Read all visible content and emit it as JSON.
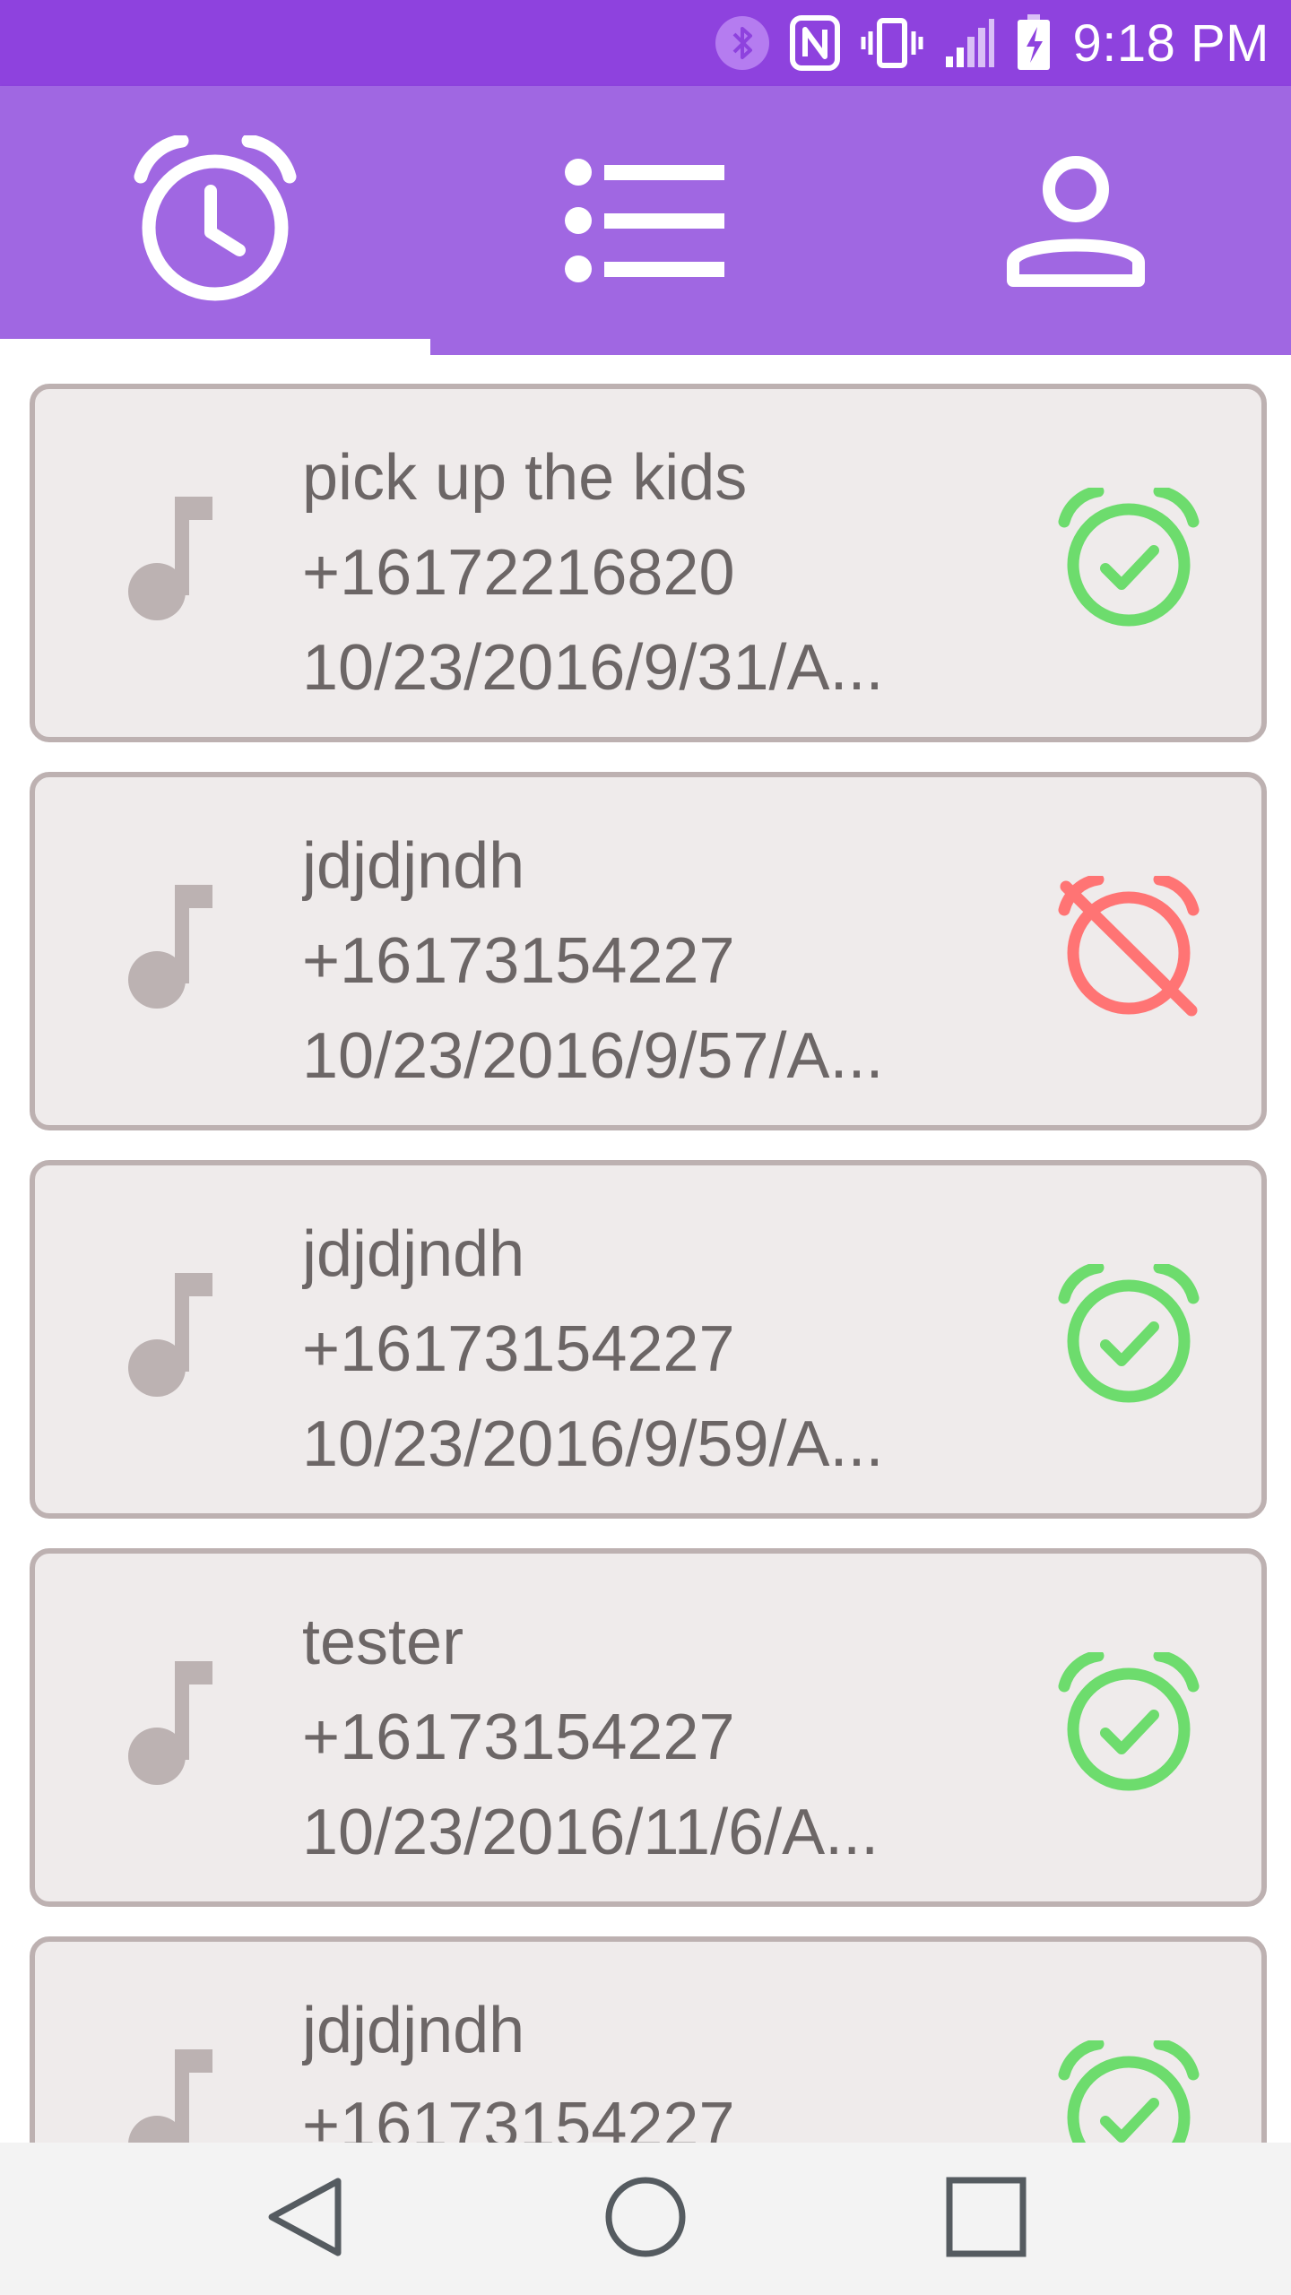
{
  "status_bar": {
    "time": "9:18 PM",
    "icons": [
      "bluetooth-icon",
      "nfc-icon",
      "vibrate-icon",
      "signal-icon",
      "battery-charging-icon"
    ]
  },
  "tabs": [
    {
      "icon": "alarm-clock-icon",
      "selected": true
    },
    {
      "icon": "list-icon",
      "selected": false
    },
    {
      "icon": "person-icon",
      "selected": false
    }
  ],
  "colors": {
    "status_bar": "#8e42de",
    "tab_bar": "#a067e2",
    "card_bg": "#efebeb",
    "card_border": "#bdb1b1",
    "text": "#6c6666",
    "active_alarm": "#6ddc6d",
    "inactive_alarm": "#ff7474"
  },
  "reminders": [
    {
      "title": "pick up the kids",
      "phone": "+16172216820",
      "datetime": "10/23/2016/9/31/A...",
      "status": "alarm-on-icon"
    },
    {
      "title": "jdjdjndh",
      "phone": "+16173154227",
      "datetime": "10/23/2016/9/57/A...",
      "status": "alarm-off-icon"
    },
    {
      "title": "jdjdjndh",
      "phone": "+16173154227",
      "datetime": "10/23/2016/9/59/A...",
      "status": "alarm-on-icon"
    },
    {
      "title": "tester",
      "phone": "+16173154227",
      "datetime": "10/23/2016/11/6/A...",
      "status": "alarm-on-icon"
    },
    {
      "title": "jdjdjndh",
      "phone": "+16173154227",
      "datetime": "",
      "status": "alarm-on-icon"
    }
  ],
  "nav_bar": {
    "buttons": [
      "back-icon",
      "home-icon",
      "recents-icon"
    ]
  }
}
